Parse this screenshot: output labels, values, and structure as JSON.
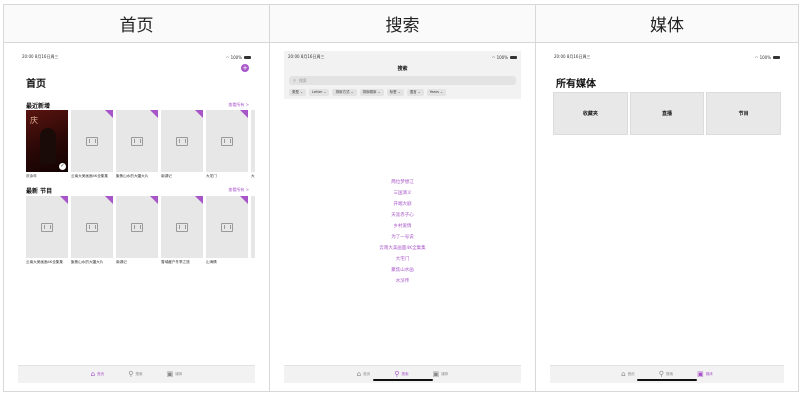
{
  "panels": {
    "home": "首页",
    "search": "搜索",
    "media": "媒体"
  },
  "statusbar": {
    "time": "20:00",
    "date": "8月16日周三",
    "battery": "100%"
  },
  "home": {
    "title": "首页",
    "recent": {
      "title": "最近新增",
      "see_all": "查看所有 >",
      "items": [
        {
          "caption": "庆余年",
          "poster": true,
          "checked": true
        },
        {
          "caption": "云南大美画面4K全集集",
          "poster": false,
          "checked": false
        },
        {
          "caption": "聚焦山水的大疆大片",
          "poster": false,
          "checked": false
        },
        {
          "caption": "南湖记",
          "poster": false,
          "checked": false
        },
        {
          "caption": "大宅门",
          "poster": false,
          "checked": false
        },
        {
          "caption": "大",
          "poster": false,
          "checked": false
        }
      ]
    },
    "newest": {
      "title": "最新 节目",
      "see_all": "查看所有 >",
      "items": [
        {
          "caption": "云南大美画面4K全集集"
        },
        {
          "caption": "聚焦山水的大疆大片"
        },
        {
          "caption": "南湖记"
        },
        {
          "caption": "雪域藏户冬季之旅"
        },
        {
          "caption": "山海情"
        },
        {
          "caption": ""
        }
      ]
    }
  },
  "search": {
    "title": "搜索",
    "placeholder": "搜索",
    "filters": [
      "类型",
      "Letter",
      "排序方式",
      "排序顺序",
      "标签",
      "语言",
      "Years"
    ],
    "suggestions": [
      "两位梦想江",
      "三国演义",
      "开端大剧",
      "天涯赤子心",
      "乡村爱情",
      "为了一号说",
      "云南大美画面4K全集集",
      "大宅门",
      "聚焦山水画",
      "水浒传"
    ]
  },
  "media": {
    "title": "所有媒体",
    "cards": [
      "收藏夹",
      "直播",
      "节目"
    ]
  },
  "tabs": [
    {
      "label": "首页",
      "icon": "house-icon"
    },
    {
      "label": "搜索",
      "icon": "magnifier-icon"
    },
    {
      "label": "媒体",
      "icon": "media-box-icon"
    }
  ],
  "colors": {
    "accent": "#a855c9",
    "panel_border": "#d8d8d8",
    "placeholder": "#e7e7e7"
  }
}
